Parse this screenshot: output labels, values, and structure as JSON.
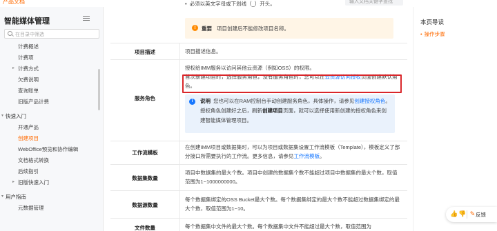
{
  "topbar": {
    "link": "产品文档",
    "search_placeholder": "输入文档关键字查找"
  },
  "sidebar": {
    "title": "智能媒体管理",
    "filter_placeholder": "在目录中筛选",
    "items": [
      {
        "label": "计费概述",
        "level": 2
      },
      {
        "label": "计费项",
        "level": 2
      },
      {
        "label": "计费方式",
        "level": 2,
        "caret": "▸"
      },
      {
        "label": "欠费说明",
        "level": 2
      },
      {
        "label": "查询账单",
        "level": 2
      },
      {
        "label": "旧版产品计费",
        "level": 2
      },
      {
        "label": "快速入门",
        "level": 1,
        "caret": "▾"
      },
      {
        "label": "开通产品",
        "level": 2
      },
      {
        "label": "创建项目",
        "level": 2,
        "active": true
      },
      {
        "label": "WebOffice预览和协作编辑",
        "level": 2
      },
      {
        "label": "文档格式转换",
        "level": 2
      },
      {
        "label": "后续指引",
        "level": 2
      },
      {
        "label": "旧版快速入门",
        "level": 2,
        "caret": "▸"
      },
      {
        "label": "用户指南",
        "level": 1,
        "caret": "▾"
      },
      {
        "label": "元数据管理",
        "level": 2
      }
    ]
  },
  "content": {
    "bullet": "必须以英文字母或下划线（_）开头。",
    "warning_label": "重要",
    "warning_text": "项目创建后不能修改项目名称。",
    "rows": {
      "desc_label": "项目描述",
      "desc_text": "项目描述信息。",
      "role_label": "服务角色",
      "role_line1": "授权给IMM服务以访问其他云资源（例如OSS）的权限。",
      "role_line2": "首次新建项目时，选择服务角色，没有服务角色时，您可以在",
      "role_link": "云资源访问授权",
      "role_line2b": "页面创建默认角色。",
      "note_label": "说明",
      "note_a": "您也可以在RAM控制台手动创建服务角色，具体操作，请参见",
      "note_link": "创建授权角色",
      "note_b": "。授权角色创建好之后，刷新",
      "note_bold": "创建项目",
      "note_c": "页面，就可以选择使用新创建的授权角色来创建智能媒体管理项目。",
      "wf_label": "工作流模板",
      "wf_text_a": "在创建IMM项目或数据集时，可以为项目或数据集设置工作流模板（Template），模板定义了部分接口所需要执行的工作流。更多信息，请参见",
      "wf_link": "工作流模板",
      "wf_text_b": "。",
      "ds_label": "数据集数量",
      "ds_text": "项目中数据集的最大个数。项目中创建的数据集个数不能超过项目中数据集的最大个数，取值范围为1~1000000000。",
      "src_label": "数据源数量",
      "src_text": "每个数据集绑定的OSS Bucket最大个数。每个数据集绑定的最大个数不能超过数据集绑定的最大个数，取值范围为1~10。",
      "file_label": "文件数量",
      "file_text": "每个数据集中文件的最大个数。每个数据集中文件不能超过最大个数，取值范围为"
    }
  },
  "toc": {
    "title": "本页导读",
    "items": [
      "操作步骤"
    ]
  },
  "floatbar": {
    "feedback": "反馈"
  }
}
